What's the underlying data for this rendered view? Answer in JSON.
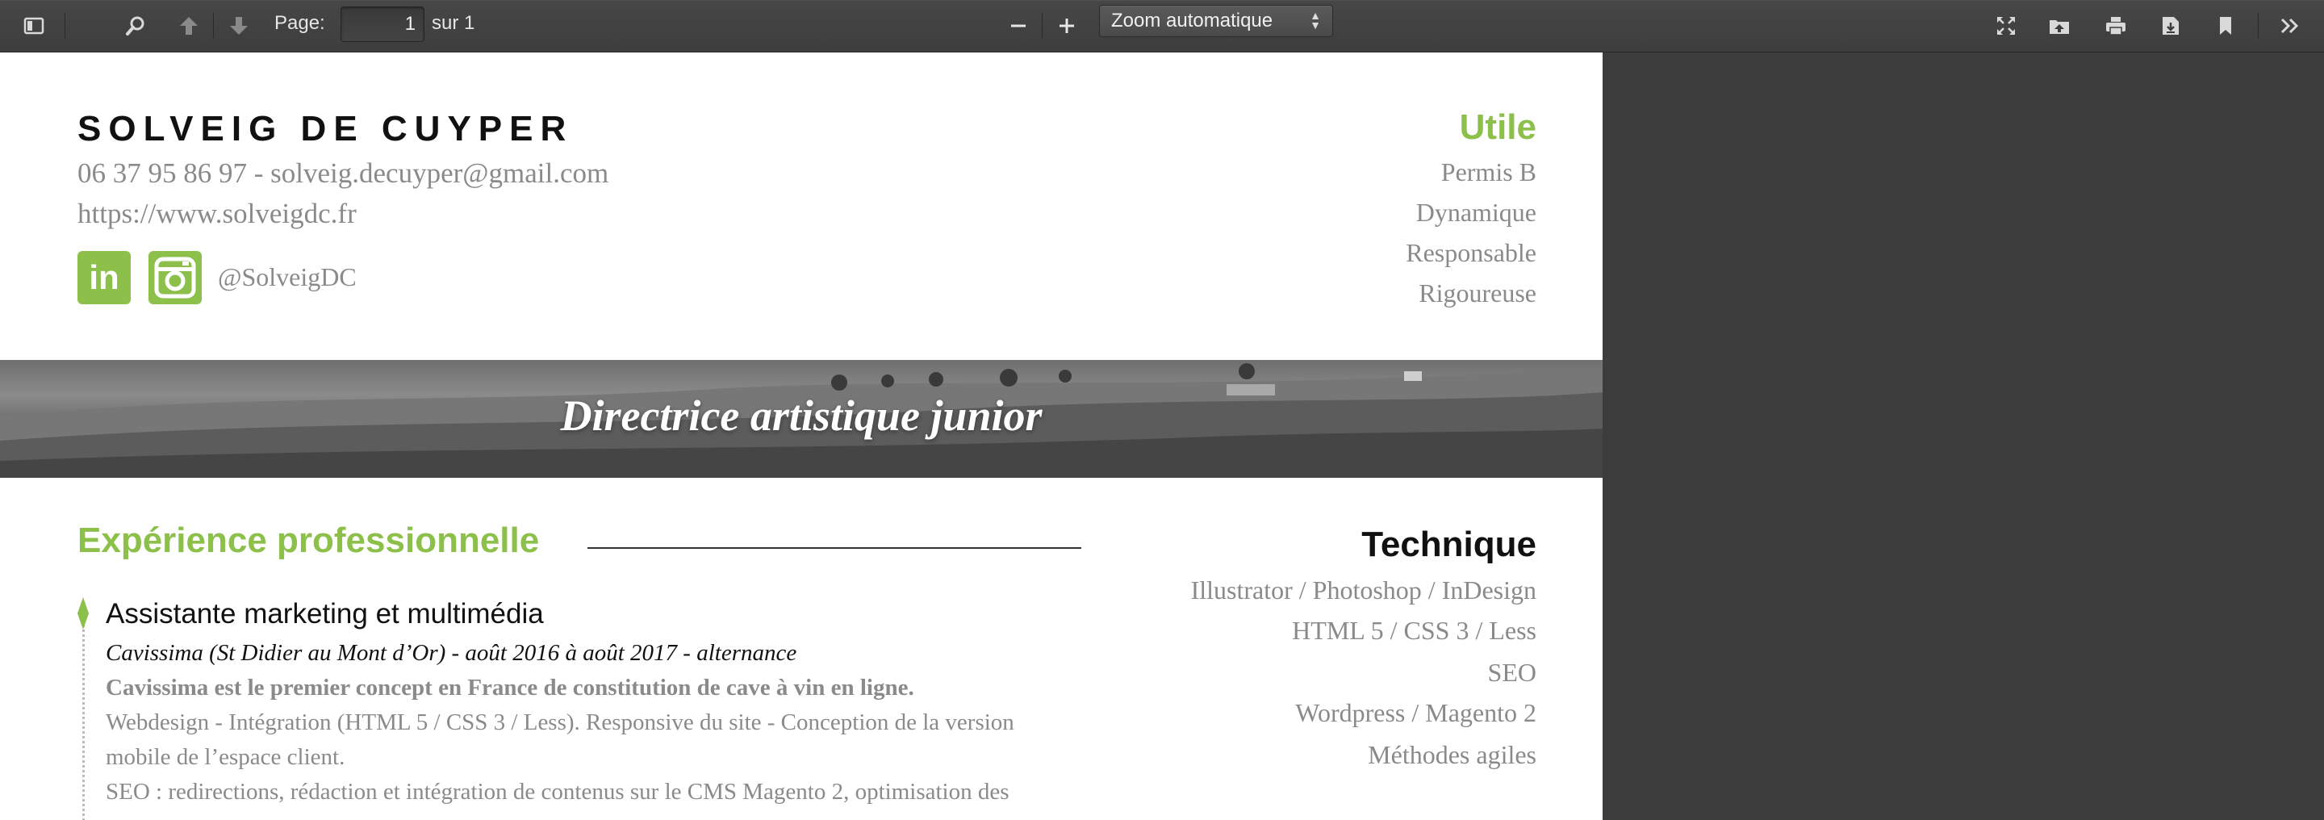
{
  "toolbar": {
    "page_label": "Page:",
    "page_value": "1",
    "page_total": "sur 1",
    "zoom_value": "Zoom automatique",
    "icons": [
      "sidebar-toggle-icon",
      "search-icon",
      "previous-page-icon",
      "next-page-icon",
      "zoom-out-icon",
      "zoom-in-icon",
      "presentation-mode-icon",
      "open-file-icon",
      "print-icon",
      "download-icon",
      "bookmark-icon",
      "tools-icon"
    ]
  },
  "cv": {
    "name": "SOLVEIG DE CUYPER",
    "contact": "06 37 95 86 97 - solveig.decuyper@gmail.com",
    "website": "https://www.solveigdc.fr",
    "linkedin_text": "in",
    "handle": "@SolveigDC",
    "utile": {
      "title": "Utile",
      "items": [
        "Permis B",
        "Dynamique",
        "Responsable",
        "Rigoureuse"
      ]
    },
    "banner_title": "Directrice artistique junior",
    "experience": {
      "title": "Expérience professionnelle",
      "job_title": "Assistante marketing et multimédia",
      "job_meta": "Cavissima (St Didier au Mont d’Or) - août 2016 à août 2017 - alternance",
      "job_lead": "Cavissima est le premier concept en France de constitution de cave à vin en ligne.",
      "desc_lines": [
        "Webdesign - Intégration (HTML 5 / CSS 3 / Less). Responsive du site - Conception de la version",
        "mobile de l’espace client.",
        "SEO : redirections, rédaction et intégration de contenus sur le CMS Magento 2, optimisation des"
      ]
    },
    "technique": {
      "title": "Technique",
      "items": [
        "Illustrator / Photoshop / InDesign",
        "HTML 5 / CSS 3 / Less",
        "SEO",
        "Wordpress / Magento 2",
        "Méthodes agiles"
      ]
    },
    "accent_color": "#8cc04b"
  }
}
